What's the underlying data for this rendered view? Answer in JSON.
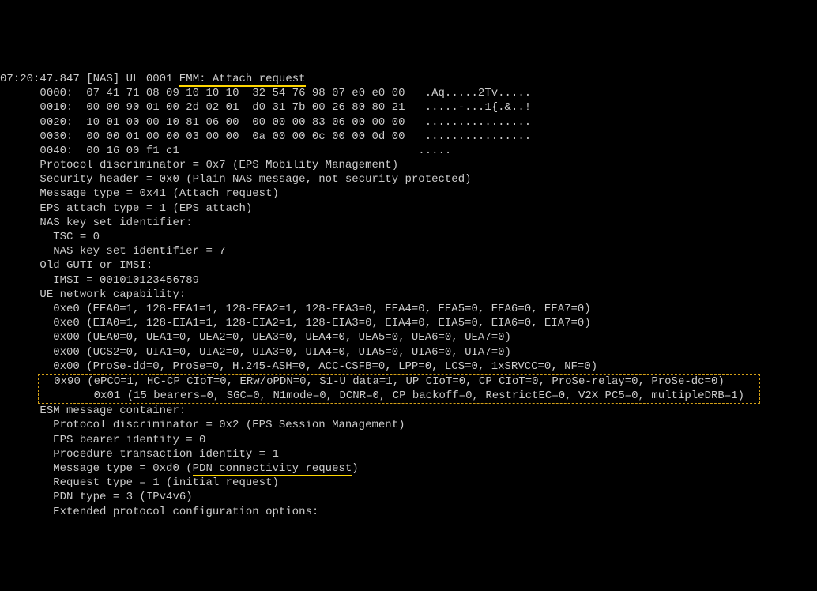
{
  "header": {
    "timestamp": "07:20:47.847",
    "source": "[NAS]",
    "direction": "UL",
    "seq": "0001",
    "msg_type": "EMM: Attach request"
  },
  "hex_dump": [
    {
      "offset": "0000:",
      "bytes": "  07 41 71 08 09 10 10 10  32 54 76 98 07 e0 e0 00",
      "ascii": "   .Aq.....2Tv....."
    },
    {
      "offset": "0010:",
      "bytes": "  00 00 90 01 00 2d 02 01  d0 31 7b 00 26 80 80 21",
      "ascii": "   .....-...1{.&..!"
    },
    {
      "offset": "0020:",
      "bytes": "  10 01 00 00 10 81 06 00  00 00 00 83 06 00 00 00",
      "ascii": "   ................"
    },
    {
      "offset": "0030:",
      "bytes": "  00 00 01 00 00 03 00 00  0a 00 00 0c 00 00 0d 00",
      "ascii": "   ................"
    },
    {
      "offset": "0040:",
      "bytes": "  00 16 00 f1 c1",
      "ascii": "                                    ....."
    }
  ],
  "decoded": {
    "protocol_discriminator": "Protocol discriminator = 0x7 (EPS Mobility Management)",
    "security_header": "Security header = 0x0 (Plain NAS message, not security protected)",
    "message_type": "Message type = 0x41 (Attach request)",
    "eps_attach_type": "EPS attach type = 1 (EPS attach)",
    "nas_ksi_label": "NAS key set identifier:",
    "tsc": "TSC = 0",
    "nas_ksi": "NAS key set identifier = 7",
    "guti_label": "Old GUTI or IMSI:",
    "imsi": "IMSI = 001010123456789",
    "ue_nc_label": "UE network capability:",
    "cap0": "0xe0 (EEA0=1, 128-EEA1=1, 128-EEA2=1, 128-EEA3=0, EEA4=0, EEA5=0, EEA6=0, EEA7=0)",
    "cap1": "0xe0 (EIA0=1, 128-EIA1=1, 128-EIA2=1, 128-EIA3=0, EIA4=0, EIA5=0, EIA6=0, EIA7=0)",
    "cap2": "0x00 (UEA0=0, UEA1=0, UEA2=0, UEA3=0, UEA4=0, UEA5=0, UEA6=0, UEA7=0)",
    "cap3": "0x00 (UCS2=0, UIA1=0, UIA2=0, UIA3=0, UIA4=0, UIA5=0, UIA6=0, UIA7=0)",
    "cap4": "0x00 (ProSe-dd=0, ProSe=0, H.245-ASH=0, ACC-CSFB=0, LPP=0, LCS=0, 1xSRVCC=0, NF=0)",
    "cap5": "0x90 (ePCO=1, HC-CP CIoT=0, ERw/oPDN=0, S1-U data=1, UP CIoT=0, CP CIoT=0, ProSe-relay=0, ProSe-dc=0)",
    "cap6": "0x01 (15 bearers=0, SGC=0, N1mode=0, DCNR=0, CP backoff=0, RestrictEC=0, V2X PC5=0, multipleDRB=1)",
    "esm_label": "ESM message container:",
    "esm_pd": "Protocol discriminator = 0x2 (EPS Session Management)",
    "esm_ebi": "EPS bearer identity = 0",
    "esm_pti": "Procedure transaction identity = 1",
    "esm_msg_type_prefix": "Message type = 0xd0 (",
    "esm_msg_type_highlight": "PDN connectivity request",
    "esm_msg_type_suffix": ")",
    "esm_req_type": "Request type = 1 (initial request)",
    "esm_pdn_type": "PDN type = 3 (IPv4v6)",
    "esm_epco": "Extended protocol configuration options:"
  }
}
